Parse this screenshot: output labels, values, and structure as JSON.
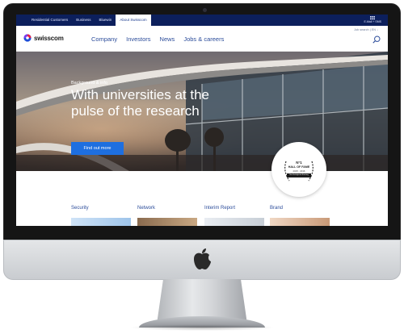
{
  "topbar": {
    "links": [
      "Residential Customers",
      "Business",
      "Bluewin",
      "About Swisscom"
    ],
    "active_index": 3,
    "right_label": "E-Mail + SMS"
  },
  "navbar": {
    "logo_text": "swisscom",
    "menu": [
      "Company",
      "Investors",
      "News",
      "Jobs & careers"
    ],
    "util_text": "Job search | EN ↓"
  },
  "hero": {
    "eyebrow": "Background & info",
    "title": "With universities at the pulse of the research",
    "button_label": "Find out more",
    "badge": {
      "number": "N°1",
      "title": "HALL OF FAME",
      "years": "2015 · 2016",
      "ribbon": "Nachhaltigkeits-Ranking"
    }
  },
  "tiles": [
    {
      "label": "Security"
    },
    {
      "label": "Network"
    },
    {
      "label": "Interim Report"
    },
    {
      "label": "Brand"
    }
  ],
  "colors": {
    "navy": "#0c1f5c",
    "link_blue": "#2b4c9a",
    "cta_blue": "#1e6fe0"
  },
  "icons": {
    "search": "search-icon",
    "apps": "grid-icon",
    "device": "apple-logo-icon"
  }
}
